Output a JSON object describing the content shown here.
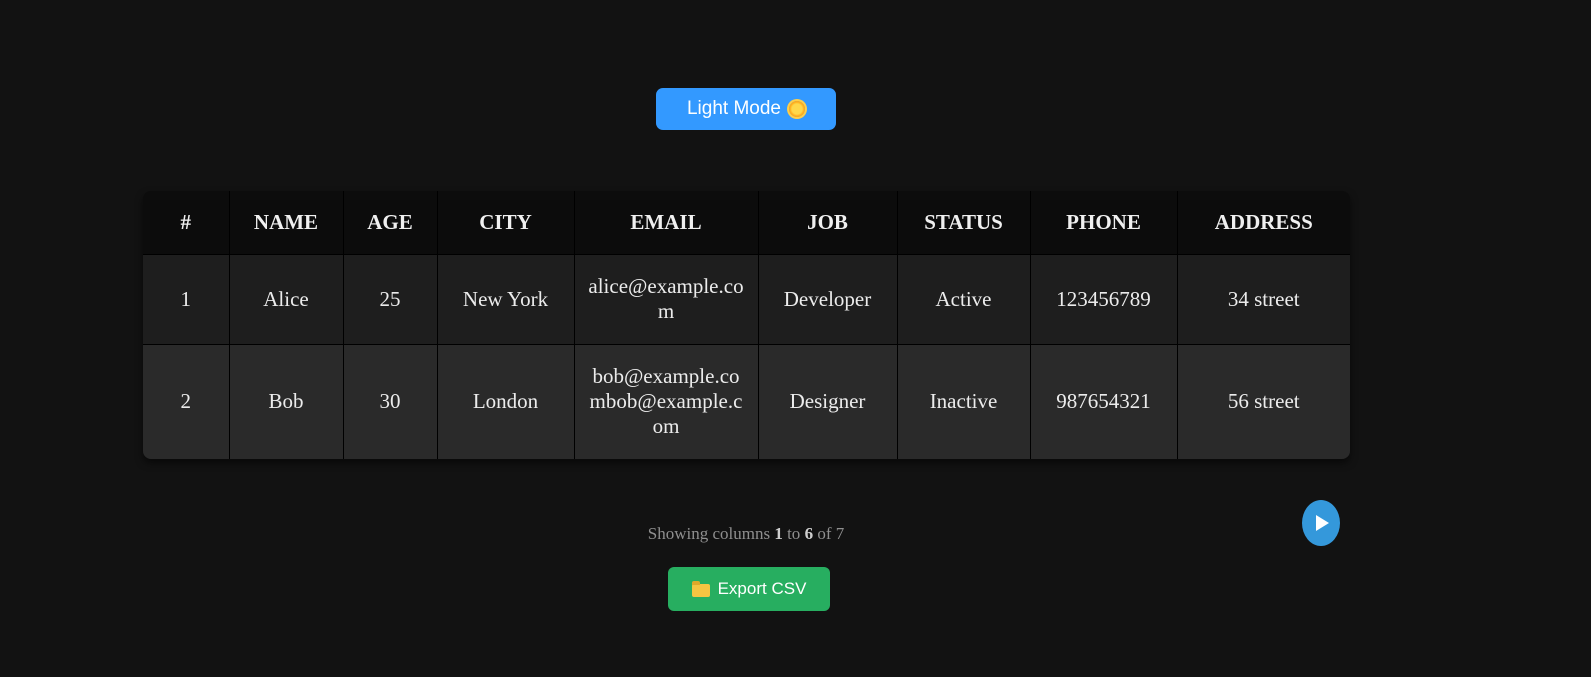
{
  "theme_toggle": {
    "label": "Light Mode",
    "icon": "sun-icon"
  },
  "table": {
    "columns": [
      "#",
      "NAME",
      "AGE",
      "CITY",
      "EMAIL",
      "JOB",
      "STATUS",
      "PHONE",
      "ADDRESS"
    ],
    "rows": [
      [
        "1",
        "Alice",
        "25",
        "New York",
        "alice@example.com",
        "Developer",
        "Active",
        "123456789",
        "34 street"
      ],
      [
        "2",
        "Bob",
        "30",
        "London",
        "bob@example.combob@example.com",
        "Designer",
        "Inactive",
        "987654321",
        "56 street"
      ]
    ]
  },
  "pagination": {
    "prefix": "Showing columns",
    "start": "1",
    "to_word": "to",
    "end": "6",
    "of_word": "of",
    "total": "7",
    "next_icon": "play-icon"
  },
  "export": {
    "label": "Export CSV",
    "icon": "folder-icon"
  },
  "colors": {
    "background": "#121212",
    "toggle": "#3399ff",
    "next": "#3498db",
    "export": "#27ae60"
  }
}
